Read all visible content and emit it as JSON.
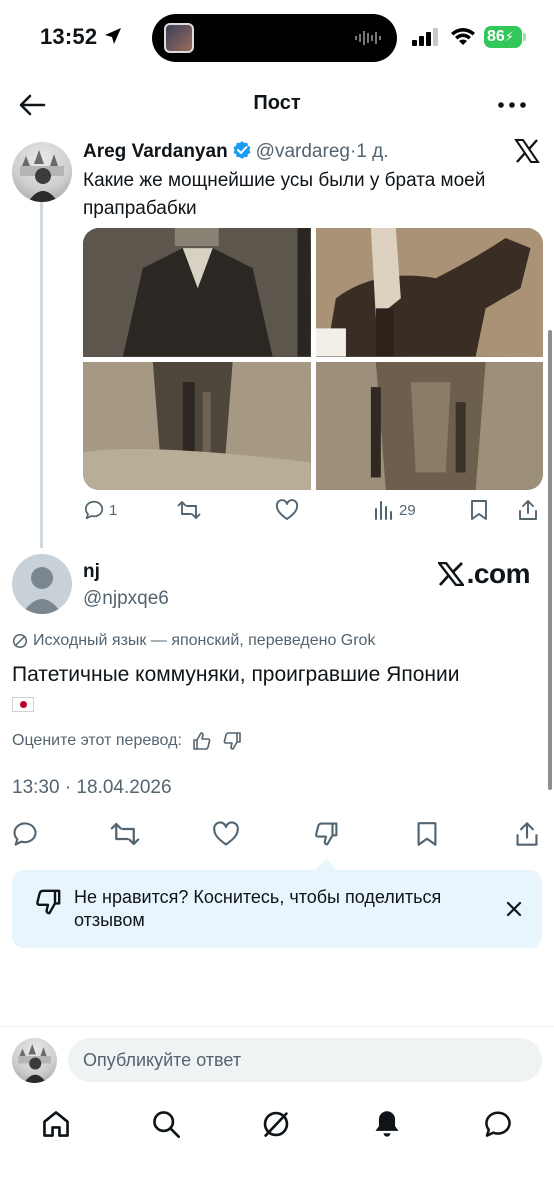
{
  "status_bar": {
    "time": "13:52",
    "battery": "86"
  },
  "header": {
    "title": "Пост"
  },
  "parent_post": {
    "name": "Areg Vardanyan",
    "handle": "@vardareg",
    "separator": "·",
    "time": "1 д.",
    "text": "Какие же мощнейшие усы были у брата моей прапрабабки",
    "actions": {
      "replies": "1",
      "views": "29"
    }
  },
  "reply": {
    "name": "nj",
    "handle": "@njpxqe6",
    "watermark": ".com",
    "translation_note": "Исходный язык — японский, переведено Grok",
    "text": "Патетичные коммуняки, проигравшие Японии",
    "rate_prompt": "Оцените этот перевод:",
    "timestamp": "13:30 · 18.04.2026"
  },
  "tooltip": {
    "text": "Не нравится? Коснитесь, чтобы поделиться отзывом"
  },
  "composer": {
    "placeholder": "Опубликуйте ответ"
  },
  "colors": {
    "accent": "#1d9bf0",
    "secondary_text": "#536471",
    "battery": "#33c759",
    "tooltip_bg": "#e8f5fd"
  },
  "icons": [
    "back-icon",
    "more-icon",
    "verified-icon",
    "x-logo-icon",
    "reply-icon",
    "repost-icon",
    "like-icon",
    "views-icon",
    "bookmark-icon",
    "share-icon",
    "dislike-icon",
    "thumbs-up-icon",
    "grok-icon",
    "close-icon",
    "home-icon",
    "search-icon",
    "bell-icon",
    "messages-icon"
  ]
}
